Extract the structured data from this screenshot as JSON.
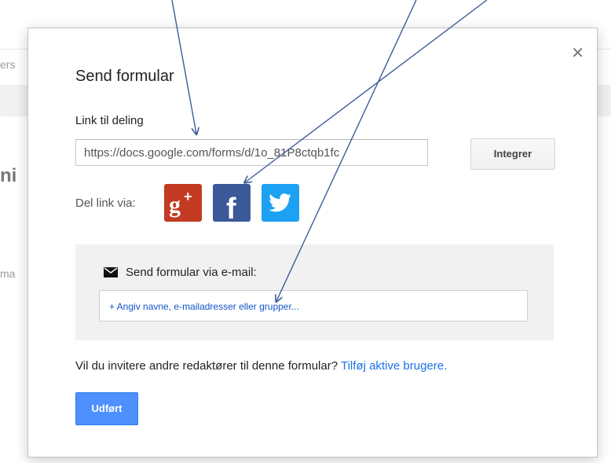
{
  "background": {
    "tab_fragment": "ers",
    "heading_fragment": "ni",
    "text_fragment": "ma"
  },
  "dialog": {
    "title": "Send formular",
    "close_icon": "close-icon",
    "link": {
      "label": "Link til deling",
      "url_value": "https://docs.google.com/forms/d/1o_81P8ctqb1fc",
      "embed_button": "Integrer"
    },
    "share": {
      "label": "Del link via:",
      "services": [
        "google-plus-icon",
        "facebook-icon",
        "twitter-icon"
      ]
    },
    "email": {
      "heading": "Send formular via e-mail:",
      "recipients_placeholder": "+ Angiv navne, e-mailadresser eller grupper..."
    },
    "invite": {
      "text": "Vil du invitere andre redaktører til denne formular?",
      "link": "Tilføj aktive brugere."
    },
    "done_button": "Udført"
  },
  "colors": {
    "primary_button": "#4d90fe",
    "link": "#1a73e8",
    "google_plus": "#c23b22",
    "facebook": "#3b5998",
    "twitter": "#1da1f2",
    "annotation_arrow": "#3d5c9a"
  }
}
